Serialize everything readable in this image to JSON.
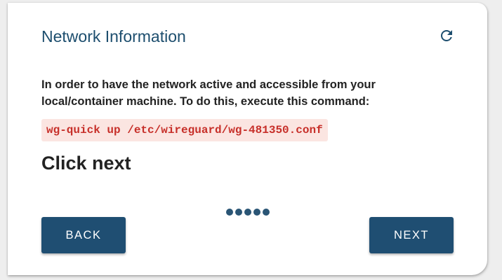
{
  "card": {
    "title": "Network Information",
    "refresh_icon": "refresh-icon",
    "description": "In order to have the network active and accessible from your local/container machine. To do this, execute this command:",
    "command": "wg-quick up /etc/wireguard/wg-481350.conf",
    "instruction": "Click next"
  },
  "stepper": {
    "dot_count": 5
  },
  "buttons": {
    "back_label": "BACK",
    "next_label": "NEXT"
  },
  "colors": {
    "title": "#1d4e6e",
    "button_bg": "#1f4e72",
    "command_text": "#c7302a",
    "command_bg": "#fbe5e1"
  }
}
